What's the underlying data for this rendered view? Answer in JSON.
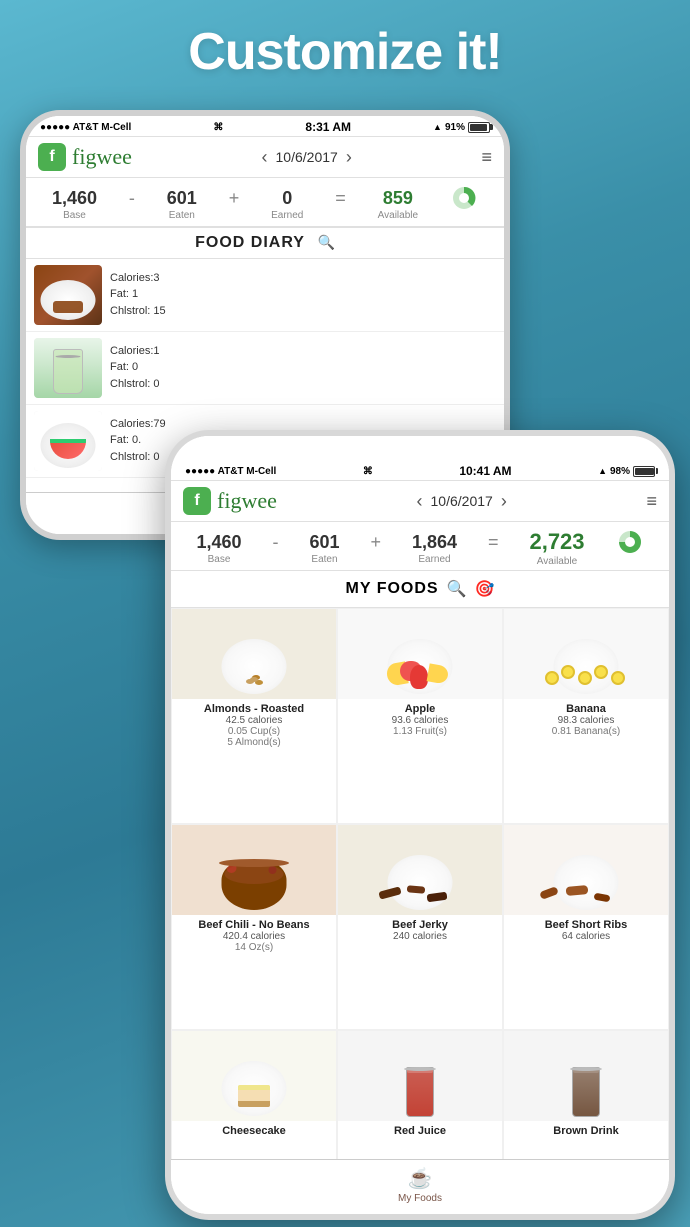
{
  "page": {
    "title": "Customize it!",
    "bg_color": "#4a9fb5"
  },
  "phone_back": {
    "status": {
      "carrier": "●●●●● AT&T M-Cell",
      "wifi": "WiFi",
      "time": "8:31 AM",
      "location": "▲",
      "battery_pct": "91%"
    },
    "header": {
      "logo_letter": "f",
      "app_name": "figwee",
      "date": "10/6/2017",
      "menu_icon": "≡"
    },
    "calories": {
      "base": "1,460",
      "base_label": "Base",
      "minus": "-",
      "eaten": "601",
      "eaten_label": "Eaten",
      "plus": "+",
      "earned": "0",
      "earned_label": "Earned",
      "equals": "=",
      "available": "859",
      "available_label": "Available"
    },
    "section": {
      "title": "FOOD DIARY",
      "search_icon": "🔍"
    },
    "diary_items": [
      {
        "name": "Meat item",
        "calories_label": "Calories:3",
        "fat_label": "Fat: 1",
        "cholesterol_label": "Chlstrol: 15"
      },
      {
        "name": "Beverage",
        "calories_label": "Calories:1",
        "fat_label": "Fat: 0",
        "cholesterol_label": "Chlstrol: 0"
      },
      {
        "name": "Watermelon",
        "calories_label": "Calories:79",
        "fat_label": "Fat: 0.",
        "cholesterol_label": "Chlstrol: 0"
      }
    ]
  },
  "phone_front": {
    "status": {
      "carrier": "●●●●● AT&T M-Cell",
      "wifi": "WiFi",
      "time": "10:41 AM",
      "location": "▲",
      "battery_pct": "98%"
    },
    "header": {
      "logo_letter": "f",
      "app_name": "figwee",
      "date": "10/6/2017",
      "menu_icon": "≡"
    },
    "calories": {
      "base": "1,460",
      "base_label": "Base",
      "minus": "-",
      "eaten": "601",
      "eaten_label": "Eaten",
      "plus": "+",
      "earned": "1,864",
      "earned_label": "Earned",
      "equals": "=",
      "available": "2,723",
      "available_label": "Available"
    },
    "section": {
      "title": "MY FOODS",
      "search_icon": "🔍",
      "target_icon": "🎯"
    },
    "tab_bar": {
      "active_tab": "My Foods",
      "active_icon": "☕",
      "active_label": "My Foods"
    },
    "foods": [
      {
        "name": "Almonds - Roasted",
        "calories": "42.5 calories",
        "detail1": "0.05 Cup(s)",
        "detail2": "5 Almond(s)",
        "color": "#d4a96a"
      },
      {
        "name": "Apple",
        "calories": "93.6 calories",
        "detail1": "1.13 Fruit(s)",
        "detail2": "",
        "color": "#e74c3c"
      },
      {
        "name": "Banana",
        "calories": "98.3 calories",
        "detail1": "0.81 Banana(s)",
        "detail2": "",
        "color": "#f1c40f"
      },
      {
        "name": "Beef Chili - No Beans",
        "calories": "420.4 calories",
        "detail1": "14 Oz(s)",
        "detail2": "",
        "color": "#7b3f00"
      },
      {
        "name": "Beef Jerky",
        "calories": "240 calories",
        "detail1": "",
        "detail2": "",
        "color": "#5a2d0c"
      },
      {
        "name": "Beef Short Ribs",
        "calories": "64 calories",
        "detail1": "",
        "detail2": "",
        "color": "#8B4513"
      },
      {
        "name": "Cheesecake",
        "calories": "",
        "detail1": "",
        "detail2": "",
        "color": "#f5deb3"
      },
      {
        "name": "Red Juice",
        "calories": "",
        "detail1": "",
        "detail2": "",
        "color": "#c0392b"
      },
      {
        "name": "Brown Drink",
        "calories": "",
        "detail1": "",
        "detail2": "",
        "color": "#6f4e37"
      }
    ]
  }
}
